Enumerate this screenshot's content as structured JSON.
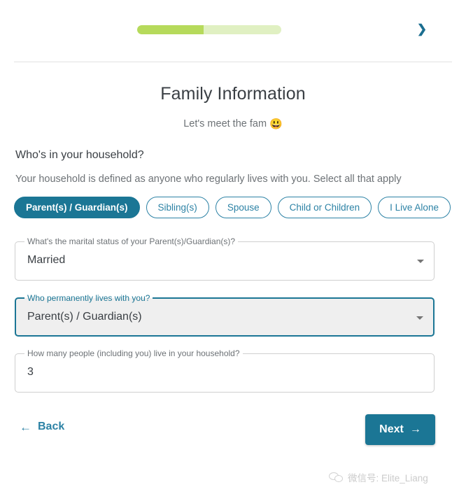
{
  "progress": {
    "percent": 46,
    "fill_color": "#b6da5b",
    "track_color": "#e0f0c2"
  },
  "header": {
    "next_chevron_icon": "chevron-right-icon",
    "accent_color": "#1b7695"
  },
  "page": {
    "title": "Family Information",
    "subtitle": "Let's meet the fam",
    "subtitle_emoji": "😃"
  },
  "question": {
    "label": "Who's in your household?",
    "help": "Your household is defined as anyone who regularly lives with you. Select all that apply",
    "chips": [
      {
        "label": "Parent(s) / Guardian(s)",
        "selected": true
      },
      {
        "label": "Sibling(s)",
        "selected": false
      },
      {
        "label": "Spouse",
        "selected": false
      },
      {
        "label": "Child or Children",
        "selected": false
      },
      {
        "label": "I Live Alone",
        "selected": false
      }
    ]
  },
  "fields": {
    "marital": {
      "label": "What's the marital status of your Parent(s)/Guardian(s)?",
      "value": "Married",
      "type": "select",
      "focused": false
    },
    "lives_with": {
      "label": "Who permanently lives with you?",
      "value": "Parent(s) / Guardian(s)",
      "type": "select",
      "focused": true
    },
    "household_size": {
      "label": "How many people (including you) live in your household?",
      "value": "3",
      "type": "text",
      "focused": false
    }
  },
  "footer": {
    "back_label": "Back",
    "back_icon": "arrow-left-icon",
    "next_label": "Next",
    "next_icon": "arrow-right-icon"
  },
  "watermark": {
    "icon": "wechat-icon",
    "text": "微信号: Elite_Liang"
  }
}
